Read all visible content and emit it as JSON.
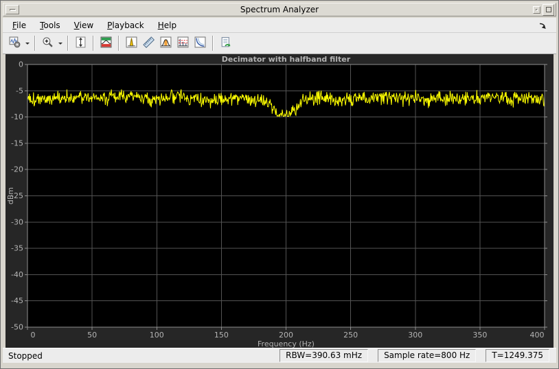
{
  "window": {
    "title": "Spectrum Analyzer",
    "controls": [
      {
        "name": "window-menu",
        "icon": "dash-icon"
      },
      {
        "name": "minimize",
        "icon": "dot-icon"
      },
      {
        "name": "maximize",
        "icon": "square-icon"
      }
    ]
  },
  "menu": {
    "items": [
      {
        "label": "File"
      },
      {
        "label": "Tools"
      },
      {
        "label": "View"
      },
      {
        "label": "Playback"
      },
      {
        "label": "Help"
      }
    ],
    "dock_icon": "dock-arrow-icon"
  },
  "toolbar": {
    "groups": [
      [
        {
          "name": "configuration-properties",
          "icon": "gear-chart-icon",
          "dropdown": true
        }
      ],
      [
        {
          "name": "zoom-in",
          "icon": "zoom-in-icon",
          "dropdown": true
        }
      ],
      [
        {
          "name": "scale-y-axis",
          "icon": "vertical-span-icon"
        }
      ],
      [
        {
          "name": "spectrum-settings",
          "icon": "spectrum-settings-icon"
        }
      ],
      [
        {
          "name": "peak-finder",
          "icon": "peak-finder-icon"
        },
        {
          "name": "cursor-measurements",
          "icon": "ruler-icon"
        },
        {
          "name": "channel-measurements",
          "icon": "channel-band-icon"
        },
        {
          "name": "distortion-measurements",
          "icon": "distortion-plot-icon"
        },
        {
          "name": "ccdf-measurements",
          "icon": "ccdf-curve-icon"
        }
      ],
      [
        {
          "name": "playback-export",
          "icon": "document-export-icon"
        }
      ]
    ]
  },
  "chart_data": {
    "type": "line",
    "title": "Decimator with halfband filter",
    "xlabel": "Frequency (Hz)",
    "ylabel": "dBm",
    "xlim": [
      0,
      400
    ],
    "ylim": [
      -50,
      0
    ],
    "x_ticks": [
      0,
      50,
      100,
      150,
      200,
      250,
      300,
      350,
      400
    ],
    "y_ticks": [
      0,
      -5,
      -10,
      -15,
      -20,
      -25,
      -30,
      -35,
      -40,
      -45,
      -50
    ],
    "grid": true,
    "plot_bg": "#000000",
    "panel_bg": "#262626",
    "grid_color": "#545454",
    "axis_color": "#8f8f8f",
    "label_color": "#b4b4b4",
    "series": [
      {
        "name": "spectrum-trace",
        "color": "#ffff00",
        "description": "Noisy spectrum around -6.3 dBm across 0-400 Hz with a notch dipping to about -9.6 dBm centered at 200 Hz",
        "noise_floor_dbm": -6.3,
        "noise_sd_db": 0.62,
        "notch_center_hz": 200,
        "notch_depth_db": 3.2,
        "notch_sigma_hz": 8,
        "clamp_dbm": [
          -9.85,
          -4.75
        ],
        "points": 1024,
        "seed": 1337
      }
    ]
  },
  "statusbar": {
    "state": "Stopped",
    "cells": [
      {
        "name": "rbw",
        "text": "RBW=390.63 mHz"
      },
      {
        "name": "sample-rate",
        "text": "Sample rate=800 Hz"
      },
      {
        "name": "time",
        "text": "T=1249.375"
      }
    ]
  }
}
